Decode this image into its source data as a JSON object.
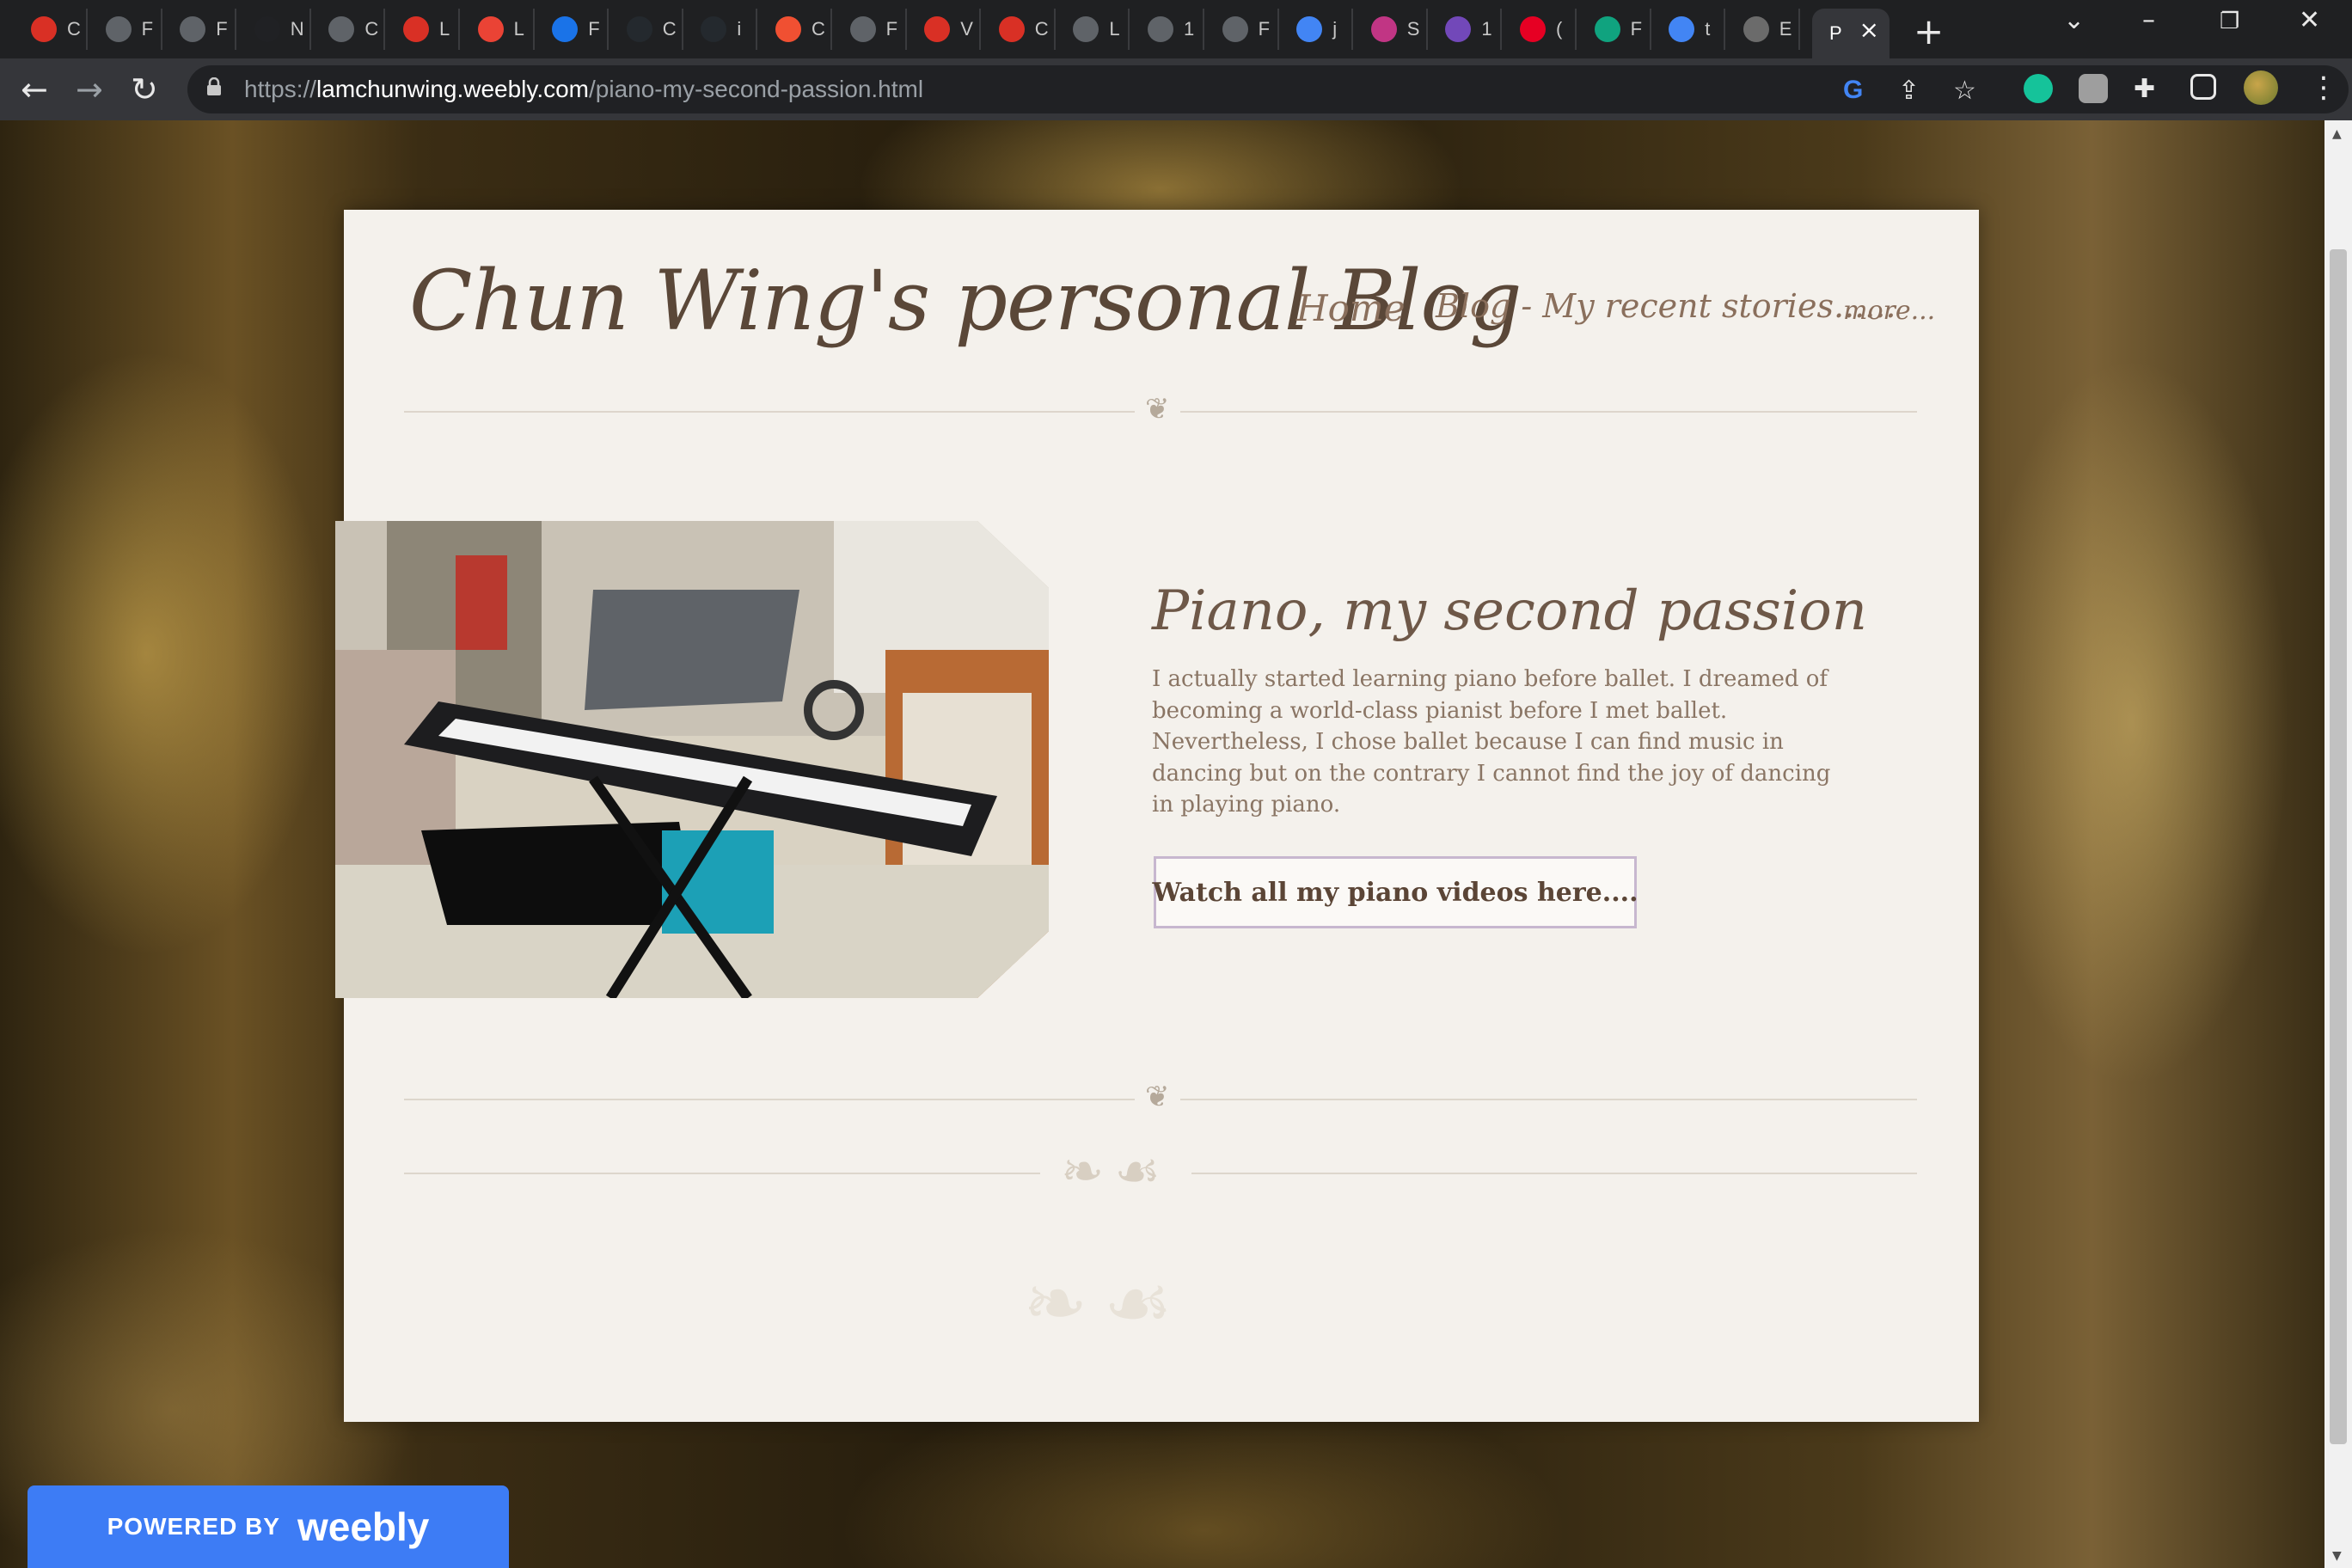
{
  "browser": {
    "tabs": [
      {
        "letter": "C",
        "color": "#d93025"
      },
      {
        "letter": "F",
        "color": "#5f6368"
      },
      {
        "letter": "F",
        "color": "#5f6368"
      },
      {
        "letter": "N",
        "color": "#202124"
      },
      {
        "letter": "C",
        "color": "#5f6368"
      },
      {
        "letter": "L",
        "color": "#d93025"
      },
      {
        "letter": "L",
        "color": "#ea4335"
      },
      {
        "letter": "F",
        "color": "#1a73e8"
      },
      {
        "letter": "C",
        "color": "#24292e"
      },
      {
        "letter": "i",
        "color": "#24292e"
      },
      {
        "letter": "C",
        "color": "#f05032"
      },
      {
        "letter": "F",
        "color": "#5f6368"
      },
      {
        "letter": "V",
        "color": "#d93025"
      },
      {
        "letter": "C",
        "color": "#d93025"
      },
      {
        "letter": "L",
        "color": "#5f6368"
      },
      {
        "letter": "1",
        "color": "#5f6368"
      },
      {
        "letter": "F",
        "color": "#5f6368"
      },
      {
        "letter": "j",
        "color": "#4285f4"
      },
      {
        "letter": "S",
        "color": "#c13584"
      },
      {
        "letter": "1",
        "color": "#7248b9"
      },
      {
        "letter": "(",
        "color": "#e60023"
      },
      {
        "letter": "F",
        "color": "#10a37f"
      },
      {
        "letter": "t",
        "color": "#4285f4"
      },
      {
        "letter": "E",
        "color": "#6b6b6b"
      }
    ],
    "active_tab_label": "P",
    "url_host": "lamchunwing.weebly.com",
    "url_scheme": "https://",
    "url_path": "/piano-my-second-passion.html"
  },
  "site": {
    "title": "Chun Wing's personal Blog",
    "nav": {
      "home": "Home",
      "blog": "Blog - My recent stories......",
      "more": "more..."
    }
  },
  "content": {
    "heading": "Piano, my second passion",
    "body": "I actually started learning piano before ballet. I dreamed of becoming a world-class pianist before I met ballet. Nevertheless, I chose ballet because I can find music in dancing but on the contrary I cannot find the joy of dancing in playing piano.",
    "button": "Watch all my piano videos here...."
  },
  "footer": {
    "powered_by": "POWERED BY",
    "brand": "weebly"
  }
}
